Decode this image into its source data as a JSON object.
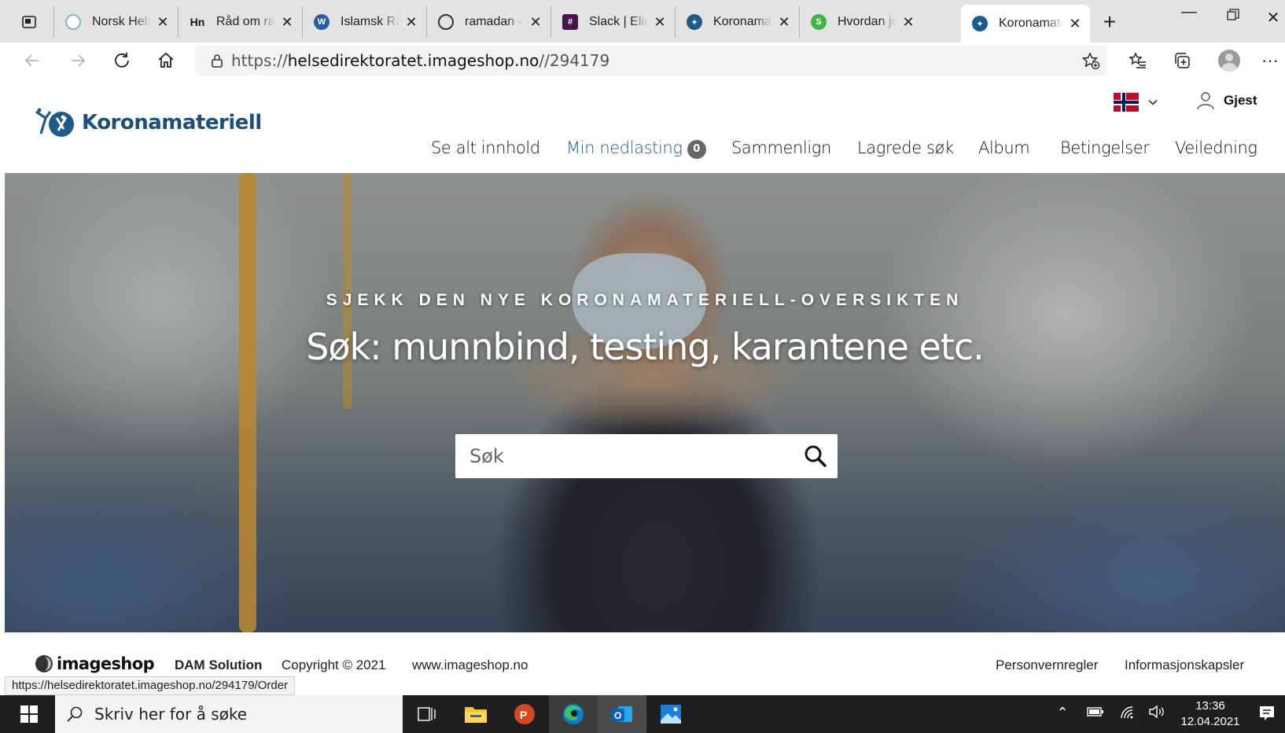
{
  "browser": {
    "tabs": [
      {
        "title": "Norsk Helse",
        "favicon_color": "#7fb8c8"
      },
      {
        "title": "Råd om ramadan",
        "favicon_text": "Hn",
        "favicon_color": "#111111"
      },
      {
        "title": "Islamsk Råd",
        "favicon_text": "W",
        "favicon_color": "#2b5d9e"
      },
      {
        "title": "ramadan – ",
        "favicon_color": "#333333"
      },
      {
        "title": "Slack | Eline",
        "favicon_color": "#4a154b"
      },
      {
        "title": "Koronamate",
        "favicon_color": "#1d5b8a"
      },
      {
        "title": "Hvordan jobb",
        "favicon_text": "S",
        "favicon_color": "#3db54a"
      },
      {
        "title": "Koronamate",
        "favicon_color": "#1d5b8a",
        "active": true
      }
    ],
    "url_prefix": "https://",
    "url_host": "helsedirektoratet.imageshop.no",
    "url_path": "//294179"
  },
  "header": {
    "logo_text": "Koronamateriell",
    "user_label": "Gjest",
    "nav": {
      "all_content": "Se alt innhold",
      "downloads": "Min nedlasting",
      "downloads_count": "0",
      "compare": "Sammenlign",
      "saved_searches": "Lagrede søk",
      "album": "Album",
      "terms": "Betingelser",
      "guide": "Veiledning"
    }
  },
  "hero": {
    "kicker": "SJEKK DEN NYE KORONAMATERIELL-OVERSIKTEN",
    "title": "Søk: munnbind, testing, karantene etc.",
    "search_placeholder": "Søk"
  },
  "footer": {
    "brand": "imageshop",
    "dam": "DAM Solution",
    "copyright": "Copyright © 2021",
    "website": "www.imageshop.no",
    "privacy": "Personvernregler",
    "cookies": "Informasjonskapsler",
    "status_url": "https://helsedirektoratet.imageshop.no/294179/Order"
  },
  "taskbar": {
    "search_placeholder": "Skriv her for å søke",
    "time": "13:36",
    "date": "12.04.2021"
  }
}
